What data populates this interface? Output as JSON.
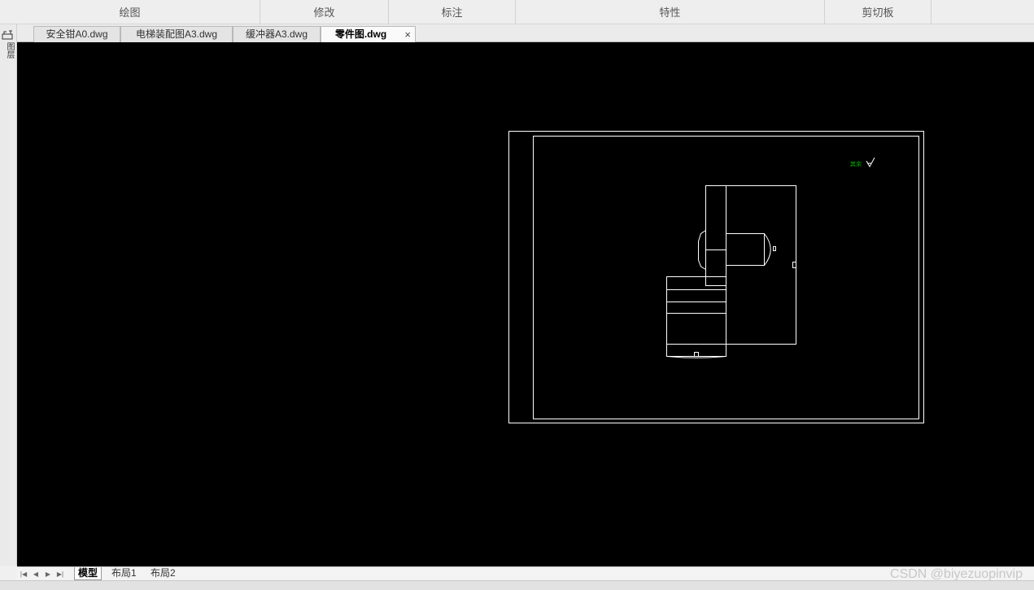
{
  "ribbon": {
    "groups": [
      "绘图",
      "修改",
      "标注",
      "特性",
      "剪切板"
    ]
  },
  "left_palette": {
    "icon": "palette-tools-icon",
    "label": "图层"
  },
  "document_tabs": [
    {
      "label": "安全钳A0.dwg",
      "active": false
    },
    {
      "label": "电梯装配图A3.dwg",
      "active": false
    },
    {
      "label": "缓冲器A3.dwg",
      "active": false
    },
    {
      "label": "零件图.dwg",
      "active": true
    }
  ],
  "close_glyph": "×",
  "canvas": {
    "background": "#000000",
    "line_color": "#ffffff",
    "symbol_color": "#00c000",
    "roughness_note": "其余"
  },
  "layout_nav": {
    "first": "first-layout-icon",
    "prev": "prev-layout-icon",
    "next": "next-layout-icon",
    "last": "last-layout-icon"
  },
  "layout_tabs": [
    {
      "label": "模型",
      "active": true
    },
    {
      "label": "布局1",
      "active": false
    },
    {
      "label": "布局2",
      "active": false
    }
  ],
  "watermark": "CSDN @biyezuopinvip"
}
